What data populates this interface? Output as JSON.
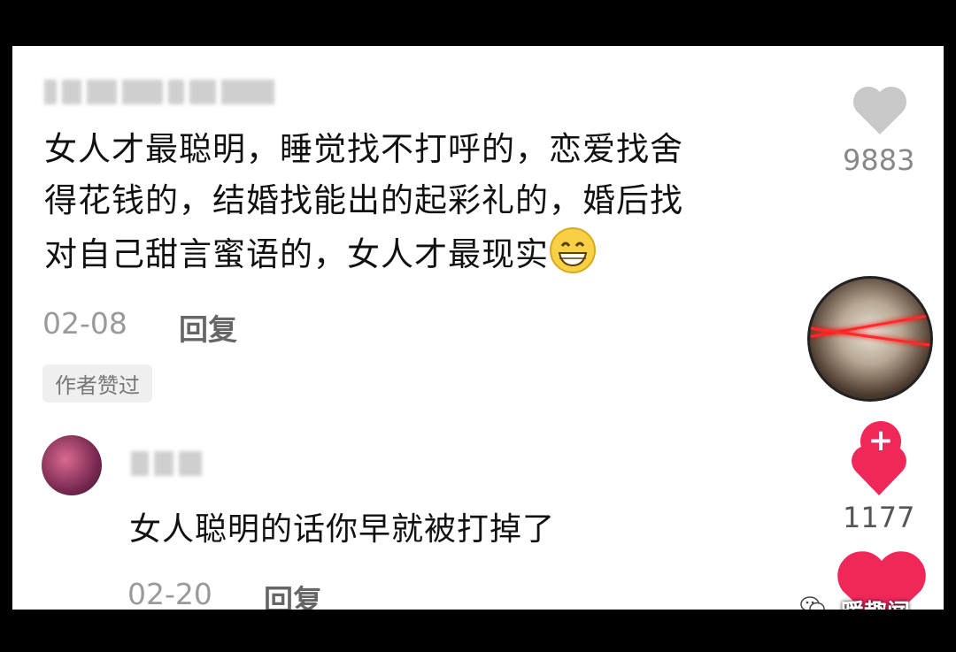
{
  "comment": {
    "lines": [
      "女人才最聪明，睡觉找不打呼的，恋爱找舍",
      "得花钱的，结婚找能出的起彩礼的，婚后找",
      "对自己甜言蜜语的，女人才最现实"
    ],
    "emoji_icon": "grinning-face-icon",
    "date": "02-08",
    "reply_label": "回复",
    "badge": "作者赞过",
    "like_count": "9883"
  },
  "reply": {
    "text": "女人聪明的话你早就被打掉了",
    "date": "02-20",
    "reply_label": "回复",
    "like_count": "1177"
  },
  "watermark": "暖趣闻",
  "colors": {
    "accent": "#f0285a",
    "heart_grey": "#c8c8c8"
  }
}
